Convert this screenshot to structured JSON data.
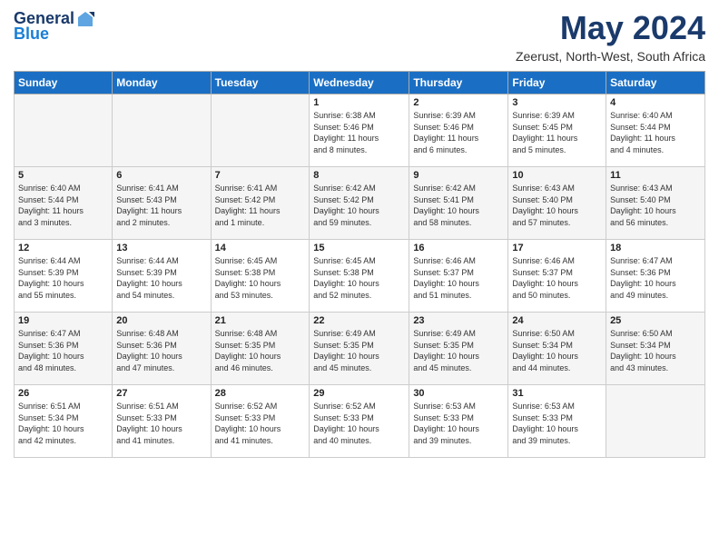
{
  "logo": {
    "general": "General",
    "blue": "Blue"
  },
  "title": "May 2024",
  "location": "Zeerust, North-West, South Africa",
  "headers": [
    "Sunday",
    "Monday",
    "Tuesday",
    "Wednesday",
    "Thursday",
    "Friday",
    "Saturday"
  ],
  "weeks": [
    [
      {
        "num": "",
        "info": "",
        "empty": true
      },
      {
        "num": "",
        "info": "",
        "empty": true
      },
      {
        "num": "",
        "info": "",
        "empty": true
      },
      {
        "num": "1",
        "info": "Sunrise: 6:38 AM\nSunset: 5:46 PM\nDaylight: 11 hours\nand 8 minutes.",
        "empty": false
      },
      {
        "num": "2",
        "info": "Sunrise: 6:39 AM\nSunset: 5:46 PM\nDaylight: 11 hours\nand 6 minutes.",
        "empty": false
      },
      {
        "num": "3",
        "info": "Sunrise: 6:39 AM\nSunset: 5:45 PM\nDaylight: 11 hours\nand 5 minutes.",
        "empty": false
      },
      {
        "num": "4",
        "info": "Sunrise: 6:40 AM\nSunset: 5:44 PM\nDaylight: 11 hours\nand 4 minutes.",
        "empty": false
      }
    ],
    [
      {
        "num": "5",
        "info": "Sunrise: 6:40 AM\nSunset: 5:44 PM\nDaylight: 11 hours\nand 3 minutes.",
        "empty": false
      },
      {
        "num": "6",
        "info": "Sunrise: 6:41 AM\nSunset: 5:43 PM\nDaylight: 11 hours\nand 2 minutes.",
        "empty": false
      },
      {
        "num": "7",
        "info": "Sunrise: 6:41 AM\nSunset: 5:42 PM\nDaylight: 11 hours\nand 1 minute.",
        "empty": false
      },
      {
        "num": "8",
        "info": "Sunrise: 6:42 AM\nSunset: 5:42 PM\nDaylight: 10 hours\nand 59 minutes.",
        "empty": false
      },
      {
        "num": "9",
        "info": "Sunrise: 6:42 AM\nSunset: 5:41 PM\nDaylight: 10 hours\nand 58 minutes.",
        "empty": false
      },
      {
        "num": "10",
        "info": "Sunrise: 6:43 AM\nSunset: 5:40 PM\nDaylight: 10 hours\nand 57 minutes.",
        "empty": false
      },
      {
        "num": "11",
        "info": "Sunrise: 6:43 AM\nSunset: 5:40 PM\nDaylight: 10 hours\nand 56 minutes.",
        "empty": false
      }
    ],
    [
      {
        "num": "12",
        "info": "Sunrise: 6:44 AM\nSunset: 5:39 PM\nDaylight: 10 hours\nand 55 minutes.",
        "empty": false
      },
      {
        "num": "13",
        "info": "Sunrise: 6:44 AM\nSunset: 5:39 PM\nDaylight: 10 hours\nand 54 minutes.",
        "empty": false
      },
      {
        "num": "14",
        "info": "Sunrise: 6:45 AM\nSunset: 5:38 PM\nDaylight: 10 hours\nand 53 minutes.",
        "empty": false
      },
      {
        "num": "15",
        "info": "Sunrise: 6:45 AM\nSunset: 5:38 PM\nDaylight: 10 hours\nand 52 minutes.",
        "empty": false
      },
      {
        "num": "16",
        "info": "Sunrise: 6:46 AM\nSunset: 5:37 PM\nDaylight: 10 hours\nand 51 minutes.",
        "empty": false
      },
      {
        "num": "17",
        "info": "Sunrise: 6:46 AM\nSunset: 5:37 PM\nDaylight: 10 hours\nand 50 minutes.",
        "empty": false
      },
      {
        "num": "18",
        "info": "Sunrise: 6:47 AM\nSunset: 5:36 PM\nDaylight: 10 hours\nand 49 minutes.",
        "empty": false
      }
    ],
    [
      {
        "num": "19",
        "info": "Sunrise: 6:47 AM\nSunset: 5:36 PM\nDaylight: 10 hours\nand 48 minutes.",
        "empty": false
      },
      {
        "num": "20",
        "info": "Sunrise: 6:48 AM\nSunset: 5:36 PM\nDaylight: 10 hours\nand 47 minutes.",
        "empty": false
      },
      {
        "num": "21",
        "info": "Sunrise: 6:48 AM\nSunset: 5:35 PM\nDaylight: 10 hours\nand 46 minutes.",
        "empty": false
      },
      {
        "num": "22",
        "info": "Sunrise: 6:49 AM\nSunset: 5:35 PM\nDaylight: 10 hours\nand 45 minutes.",
        "empty": false
      },
      {
        "num": "23",
        "info": "Sunrise: 6:49 AM\nSunset: 5:35 PM\nDaylight: 10 hours\nand 45 minutes.",
        "empty": false
      },
      {
        "num": "24",
        "info": "Sunrise: 6:50 AM\nSunset: 5:34 PM\nDaylight: 10 hours\nand 44 minutes.",
        "empty": false
      },
      {
        "num": "25",
        "info": "Sunrise: 6:50 AM\nSunset: 5:34 PM\nDaylight: 10 hours\nand 43 minutes.",
        "empty": false
      }
    ],
    [
      {
        "num": "26",
        "info": "Sunrise: 6:51 AM\nSunset: 5:34 PM\nDaylight: 10 hours\nand 42 minutes.",
        "empty": false
      },
      {
        "num": "27",
        "info": "Sunrise: 6:51 AM\nSunset: 5:33 PM\nDaylight: 10 hours\nand 41 minutes.",
        "empty": false
      },
      {
        "num": "28",
        "info": "Sunrise: 6:52 AM\nSunset: 5:33 PM\nDaylight: 10 hours\nand 41 minutes.",
        "empty": false
      },
      {
        "num": "29",
        "info": "Sunrise: 6:52 AM\nSunset: 5:33 PM\nDaylight: 10 hours\nand 40 minutes.",
        "empty": false
      },
      {
        "num": "30",
        "info": "Sunrise: 6:53 AM\nSunset: 5:33 PM\nDaylight: 10 hours\nand 39 minutes.",
        "empty": false
      },
      {
        "num": "31",
        "info": "Sunrise: 6:53 AM\nSunset: 5:33 PM\nDaylight: 10 hours\nand 39 minutes.",
        "empty": false
      },
      {
        "num": "",
        "info": "",
        "empty": true
      }
    ]
  ]
}
